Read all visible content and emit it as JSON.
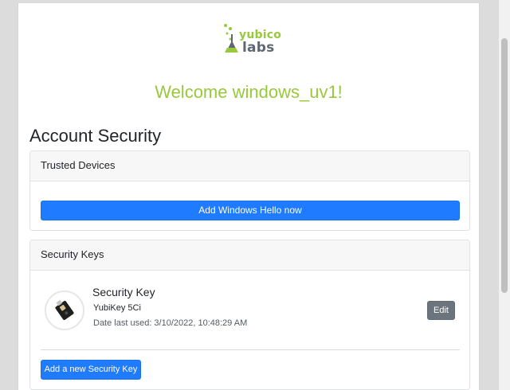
{
  "logo": {
    "brand_top": "yubico",
    "brand_bottom": "labs"
  },
  "header": {
    "welcome_text": "Welcome windows_uv1!"
  },
  "account_security": {
    "title": "Account Security"
  },
  "trusted_devices": {
    "title": "Trusted Devices",
    "primary_button_label": "Add Windows Hello now"
  },
  "security_keys": {
    "title": "Security Keys",
    "items": [
      {
        "name": "Security Key",
        "model": "YubiKey 5Ci",
        "last_used": "Date last used: 3/10/2022, 10:48:29 AM",
        "edit_label": "Edit",
        "icon": "security-key-icon"
      }
    ],
    "add_button_label": "Add a new Security Key"
  },
  "theme": {
    "accent_green": "#98c93c",
    "primary_blue": "#1f7bff",
    "secondary_gray": "#6c757d",
    "text_dark": "#212529"
  },
  "icons": {
    "logo": "flask-icon",
    "device": "security-key-icon"
  }
}
